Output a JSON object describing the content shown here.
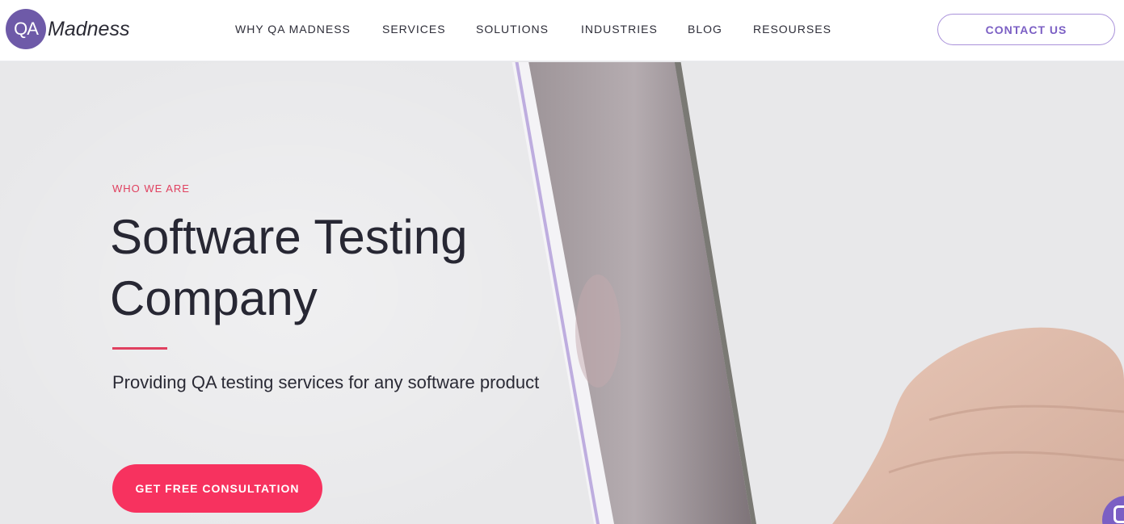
{
  "header": {
    "logo": {
      "mark": "QA",
      "word": "Madness"
    },
    "nav": [
      {
        "label": "WHY QA MADNESS"
      },
      {
        "label": "SERVICES"
      },
      {
        "label": "SOLUTIONS"
      },
      {
        "label": "INDUSTRIES"
      },
      {
        "label": "BLOG"
      },
      {
        "label": "RESOURSES"
      }
    ],
    "contact_label": "CONTACT US"
  },
  "hero": {
    "eyebrow": "WHO WE ARE",
    "title_line1": "Software Testing",
    "title_line2": "Company",
    "subtitle": "Providing QA testing services for any software product",
    "cta_label": "GET FREE CONSULTATION"
  },
  "colors": {
    "brand_purple": "#6e5aa8",
    "accent_pink": "#f7325f",
    "eyebrow_red": "#e0405f"
  },
  "icons": {
    "chat": "chat-bubble-icon"
  }
}
